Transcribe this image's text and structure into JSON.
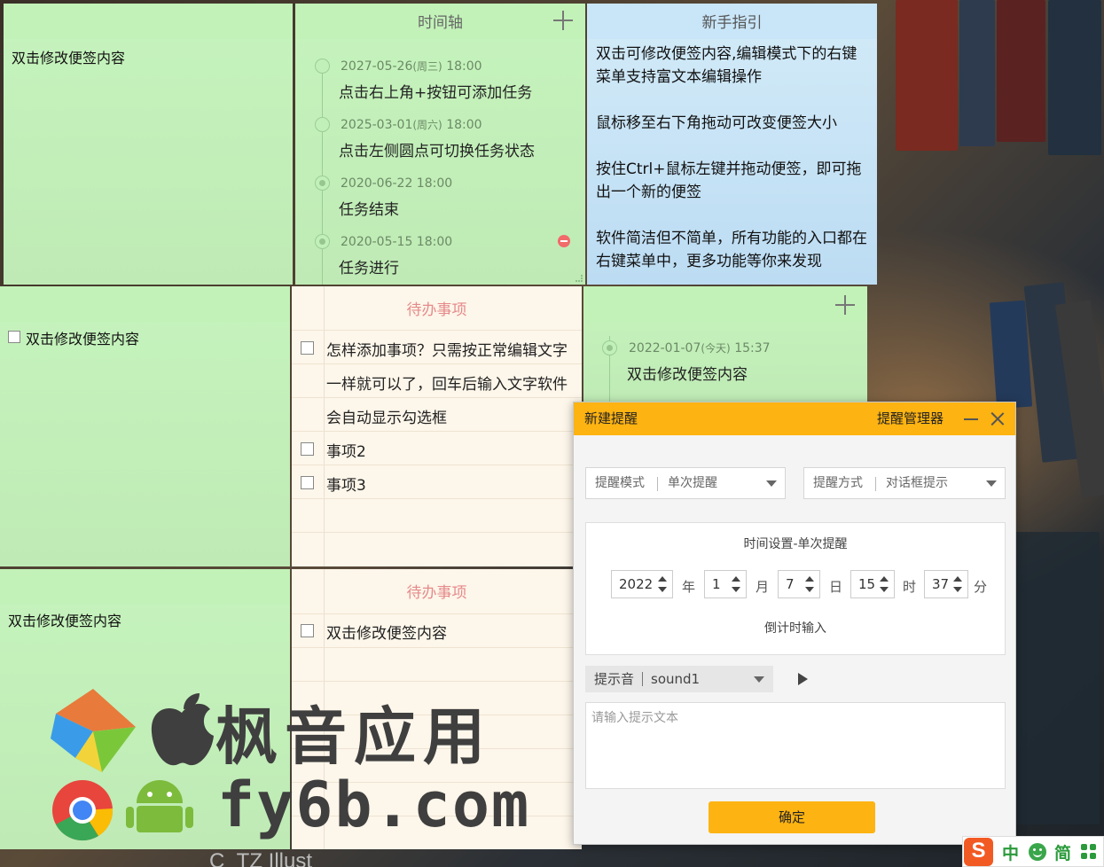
{
  "notes": {
    "top_left": {
      "text": "双击修改便签内容"
    },
    "timeline_1": {
      "title": "时间轴",
      "items": [
        {
          "date": "2027-05-26",
          "weekday": "(周三)",
          "time": " 18:00",
          "text": "点击右上角+按钮可添加任务",
          "done": false
        },
        {
          "date": "2025-03-01",
          "weekday": "(周六)",
          "time": " 18:00",
          "text": "点击左侧圆点可切换任务状态",
          "done": false
        },
        {
          "date": "2020-06-22 18:00",
          "weekday": "",
          "time": "",
          "text": "任务结束",
          "done": true
        },
        {
          "date": "2020-05-15 18:00",
          "weekday": "",
          "time": "",
          "text": "任务进行",
          "done": true
        }
      ]
    },
    "guide": {
      "title": "新手指引",
      "paragraphs": [
        "双击可修改便签内容,编辑模式下的右键菜单支持富文本编辑操作",
        "鼠标移至右下角拖动可改变便签大小",
        "按住Ctrl+鼠标左键并拖动便签，即可拖出一个新的便签",
        "软件简洁但不简单，所有功能的入口都在右键菜单中，更多功能等你来发现"
      ]
    },
    "mid_left": {
      "text": "双击修改便签内容",
      "checked": false
    },
    "todo_1": {
      "title": "待办事项",
      "items": [
        {
          "line1": "怎样添加事项？只需按正常编辑文字",
          "line2": "一样就可以了，回车后输入文字软件",
          "line3": "会自动显示勾选框",
          "checked": false
        },
        {
          "line1": "事项2",
          "checked": false
        },
        {
          "line1": "事项3",
          "checked": false
        }
      ]
    },
    "timeline_2": {
      "items": [
        {
          "date": "2022-01-07",
          "weekday": "(今天)",
          "time": " 15:37",
          "text": "双击修改便签内容"
        }
      ]
    },
    "bottom_left": {
      "text": "双击修改便签内容"
    },
    "todo_2": {
      "title": "待办事项",
      "items": [
        {
          "line1": "双击修改便签内容",
          "checked": false
        }
      ]
    }
  },
  "dialog": {
    "title": "新建提醒",
    "manager_link": "提醒管理器",
    "mode": {
      "label": "提醒模式",
      "value": "单次提醒"
    },
    "method": {
      "label": "提醒方式",
      "value": "对话框提示"
    },
    "time_panel": {
      "title": "时间设置-单次提醒",
      "year": "2022",
      "year_unit": "年",
      "month": "1",
      "month_unit": "月",
      "day": "7",
      "day_unit": "日",
      "hour": "15",
      "hour_unit": "时",
      "minute": "37",
      "minute_unit": "分",
      "countdown_link": "倒计时输入"
    },
    "sound": {
      "label": "提示音",
      "value": "sound1"
    },
    "text_placeholder": "请输入提示文本",
    "confirm_label": "确定"
  },
  "watermark": {
    "brand": "枫音应用",
    "url": "fy6b.com"
  },
  "ime": {
    "lang": "中",
    "mode": "简"
  },
  "desktop": {
    "bottom_text": "C_TZ Illust"
  },
  "colors": {
    "note_green": "#c6f4bd",
    "todo_paper": "#fdf6ea",
    "guide_blue": "#c9e6f9",
    "dialog_accent": "#fdb311",
    "todo_title": "#e58a8a"
  }
}
